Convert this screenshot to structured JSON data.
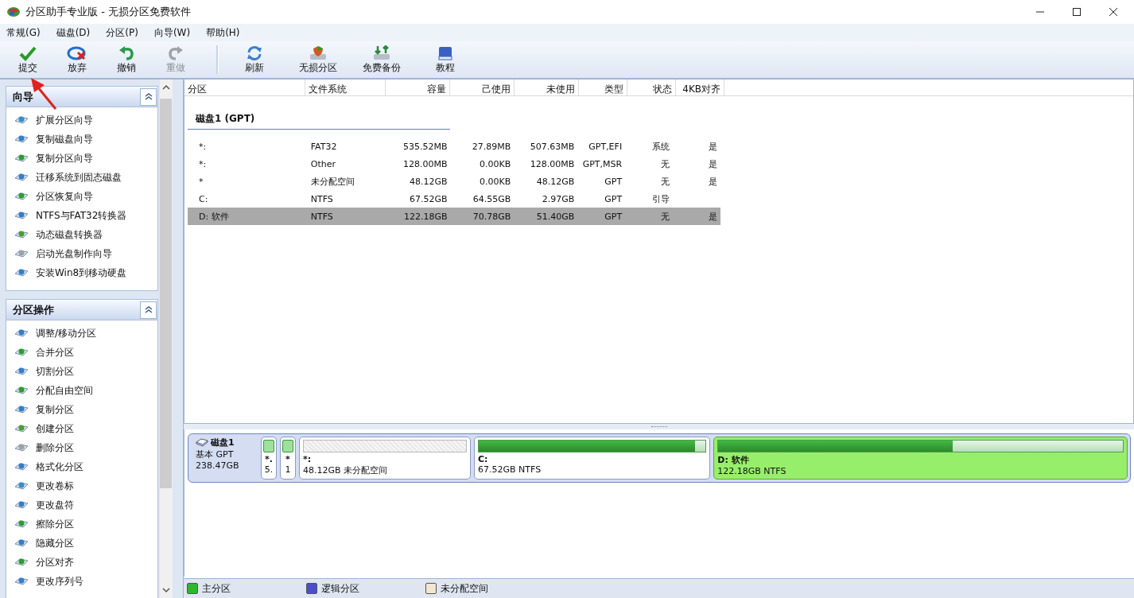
{
  "window": {
    "title": "分区助手专业版 - 无损分区免费软件"
  },
  "menu": [
    "常规(G)",
    "磁盘(D)",
    "分区(P)",
    "向导(W)",
    "帮助(H)"
  ],
  "toolbar_groups": [
    {
      "buttons": [
        {
          "label": "提交",
          "kind": "commit",
          "disabled": false
        },
        {
          "label": "放弃",
          "kind": "discard",
          "disabled": false
        },
        {
          "label": "撤销",
          "kind": "undo",
          "disabled": false
        },
        {
          "label": "重做",
          "kind": "redo",
          "disabled": true
        }
      ]
    },
    {
      "buttons": [
        {
          "label": "刷新",
          "kind": "refresh",
          "disabled": false
        },
        {
          "label": "无损分区",
          "kind": "shield",
          "disabled": false
        },
        {
          "label": "免费备份",
          "kind": "backup",
          "disabled": false
        },
        {
          "label": "教程",
          "kind": "book",
          "disabled": false
        }
      ]
    }
  ],
  "sidebar": {
    "panels": [
      {
        "title": "向导",
        "expanded": true,
        "items": [
          "扩展分区向导",
          "复制磁盘向导",
          "复制分区向导",
          "迁移系统到固态磁盘",
          "分区恢复向导",
          "NTFS与FAT32转换器",
          "动态磁盘转换器",
          "启动光盘制作向导",
          "安装Win8到移动硬盘"
        ]
      },
      {
        "title": "分区操作",
        "expanded": true,
        "items": [
          "调整/移动分区",
          "合并分区",
          "切割分区",
          "分配自由空间",
          "复制分区",
          "创建分区",
          "删除分区",
          "格式化分区",
          "更改卷标",
          "更改盘符",
          "擦除分区",
          "隐藏分区",
          "分区对齐",
          "更改序列号"
        ]
      }
    ]
  },
  "table": {
    "columns": [
      "分区",
      "文件系统",
      "容量",
      "己使用",
      "未使用",
      "类型",
      "状态",
      "4KB对齐"
    ],
    "group": "磁盘1 (GPT)",
    "rows": [
      {
        "cells": [
          "*:",
          "FAT32",
          "535.52MB",
          "27.89MB",
          "507.63MB",
          "GPT,EFI",
          "系统",
          "是"
        ],
        "selected": false
      },
      {
        "cells": [
          "*:",
          "Other",
          "128.00MB",
          "0.00KB",
          "128.00MB",
          "GPT,MSR",
          "无",
          "是"
        ],
        "selected": false
      },
      {
        "cells": [
          "*",
          "未分配空间",
          "48.12GB",
          "0.00KB",
          "48.12GB",
          "GPT",
          "无",
          "是"
        ],
        "selected": false
      },
      {
        "cells": [
          "C:",
          "NTFS",
          "67.52GB",
          "64.55GB",
          "2.97GB",
          "GPT",
          "引导",
          ""
        ],
        "selected": false
      },
      {
        "cells": [
          "D: 软件",
          "NTFS",
          "122.18GB",
          "70.78GB",
          "51.40GB",
          "GPT",
          "无",
          "是"
        ],
        "selected": true
      }
    ]
  },
  "disk_map": {
    "disk": {
      "name": "磁盘1",
      "type": "基本 GPT",
      "size": "238.47GB"
    },
    "partitions": [
      {
        "kind": "small",
        "name": "*.",
        "detail": "5.",
        "selected": false
      },
      {
        "kind": "small",
        "name": "*",
        "detail": "1",
        "selected": false
      },
      {
        "kind": "unallocated",
        "name": "*:",
        "detail": "48.12GB 未分配空间",
        "selected": false
      },
      {
        "kind": "primary",
        "name": "C:",
        "detail": "67.52GB NTFS",
        "level": 0.955,
        "selected": false
      },
      {
        "kind": "primary",
        "name": "D: 软件",
        "detail": "122.18GB NTFS",
        "level": 0.58,
        "selected": true
      }
    ]
  },
  "legend": [
    {
      "label": "主分区",
      "color": "#2fb62f"
    },
    {
      "label": "逻辑分区",
      "color": "#4b4fc8"
    },
    {
      "label": "未分配空间",
      "color": "#f2e6d2"
    }
  ]
}
